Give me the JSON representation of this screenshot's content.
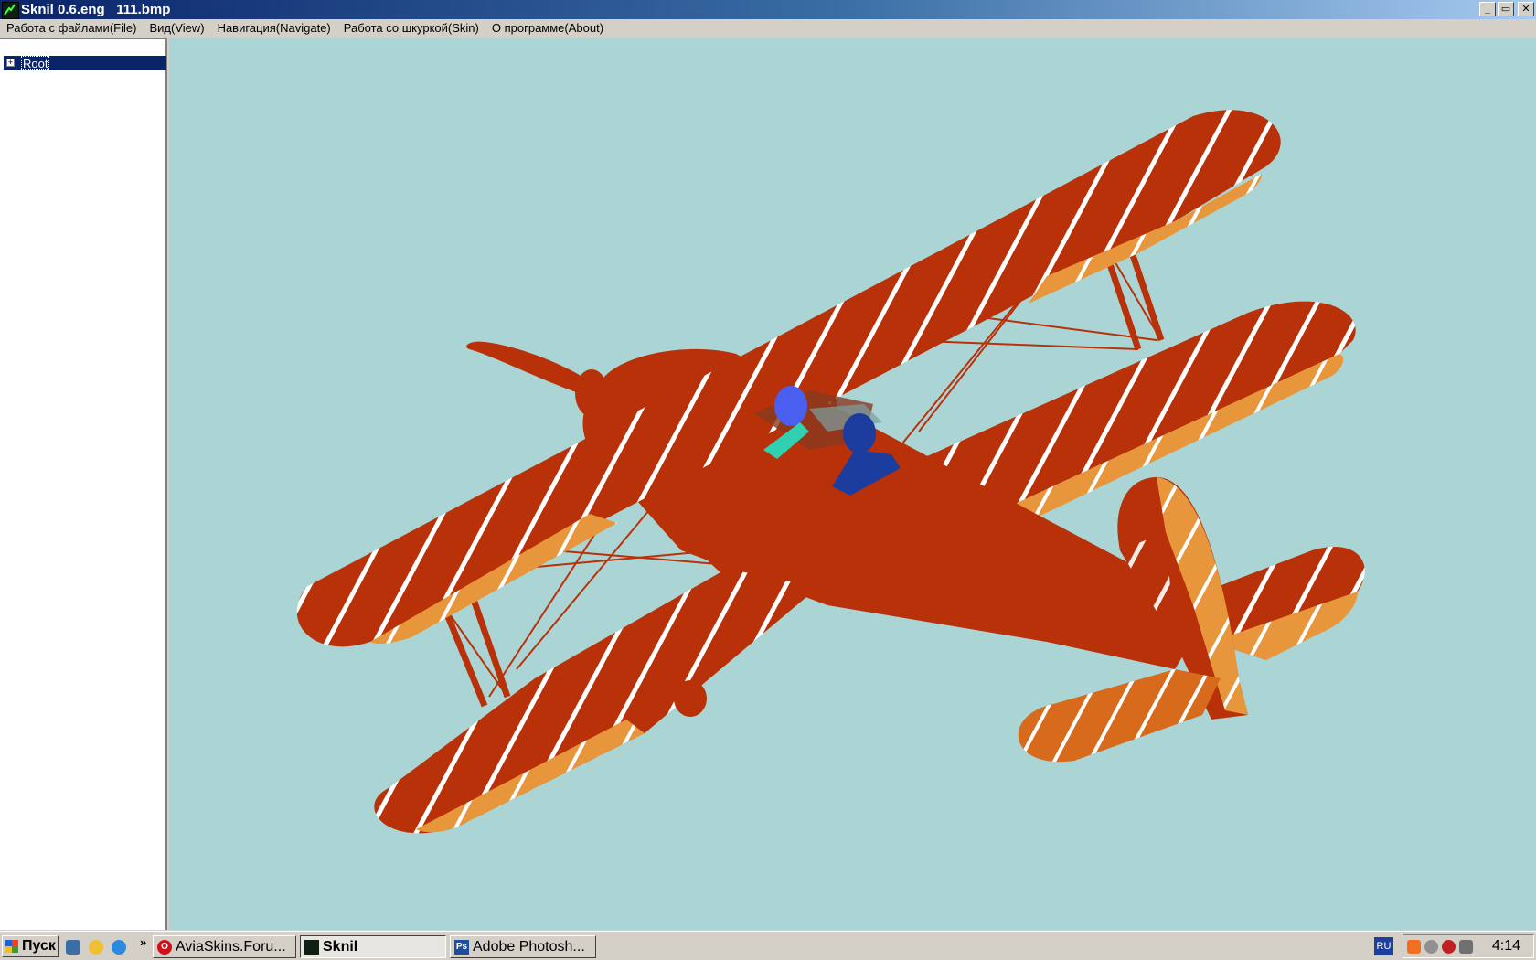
{
  "window": {
    "title": "Sknil 0.6.eng   111.bmp",
    "controls": [
      "_",
      "▭",
      "✕"
    ]
  },
  "menu": [
    {
      "label": "Работа с файлами(File)"
    },
    {
      "label": "Вид(View)"
    },
    {
      "label": "Навигация(Navigate)"
    },
    {
      "label": "Работа со шкуркой(Skin)"
    },
    {
      "label": "О программе(About)"
    }
  ],
  "tree": {
    "root_label": "Root",
    "expander": "+"
  },
  "viewport": {
    "background_color": "#aad5d4",
    "model": "biplane",
    "skin_color": "#b83108",
    "stripe_color": "#ffffff",
    "underside_color": "#e8963c",
    "pilot_colors": [
      "#4a5ef0",
      "#1c3c9e",
      "#30d0b0"
    ]
  },
  "taskbar": {
    "start_label": "Пуск",
    "quick_launch_more": "»",
    "tasks": [
      {
        "label": "AviaSkins.Foru...",
        "icon": "opera-icon",
        "active": false
      },
      {
        "label": "Sknil",
        "icon": "sknil-icon",
        "active": true
      },
      {
        "label": "Adobe Photosh...",
        "icon": "photoshop-icon",
        "active": false
      }
    ],
    "language": "RU",
    "clock": "4:14"
  }
}
